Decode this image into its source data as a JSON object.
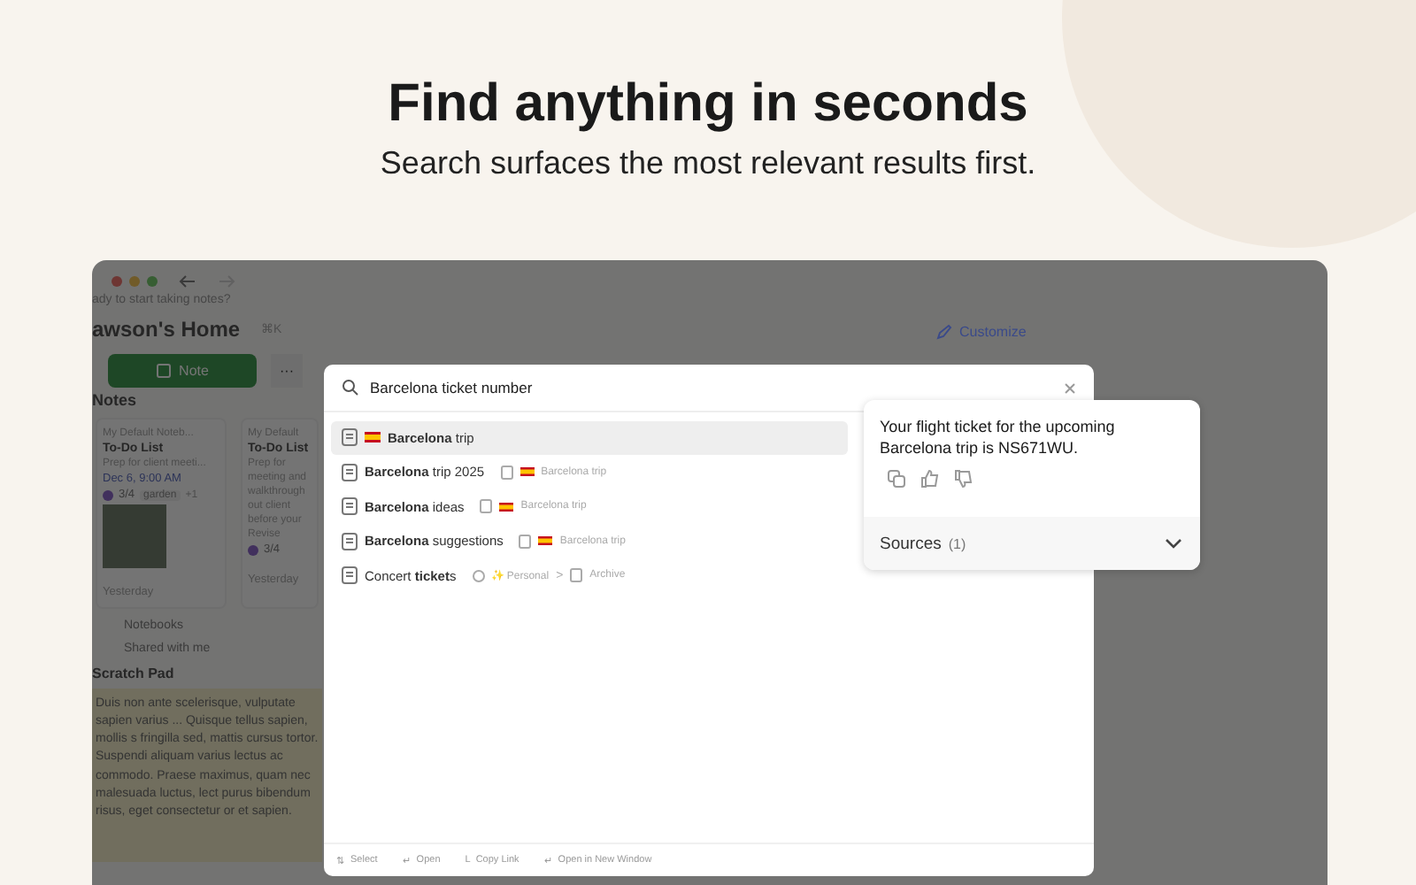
{
  "hero": {
    "title": "Find anything in seconds",
    "subtitle": "Search surfaces the most relevant results first."
  },
  "app": {
    "greeting": "ady to start taking notes?",
    "home_title": "awson's Home",
    "shortcut": "⌘K",
    "note_button": "Note",
    "more_button": "···",
    "customize": "Customize",
    "section": "Notes",
    "cards": [
      {
        "notebook": "My Default Noteb...",
        "title": "To-Do List",
        "lines": [
          "Prep for client meeti..."
        ],
        "date": "Dec 6, 9:00 AM",
        "progress": "3/4",
        "tag": "garden",
        "extra": "+1",
        "photo": true,
        "footer": "Yesterday"
      },
      {
        "notebook": "My Default",
        "title": "To-Do List",
        "lines": [
          "Prep for",
          "meeting and",
          "walkthrough",
          "out client",
          "before your",
          "Revise"
        ],
        "progress": "3/4",
        "footer": "Yesterday"
      }
    ],
    "sidebar": [
      "Notebooks",
      "Shared with me"
    ],
    "scratch_title": "Scratch Pad",
    "scratch_text": "Duis non ante scelerisque, vulputate sapien varius ... Quisque tellus sapien, mollis s fringilla sed, mattis cursus tortor. Suspendi aliquam varius lectus ac commodo. Praese maximus, quam nec malesuada luctus, lect purus bibendum risus, eget consectetur or et sapien."
  },
  "search": {
    "value": "Barcelona ticket number",
    "results": [
      {
        "title": "**Barcelona** trip",
        "flag": true,
        "selected": true
      },
      {
        "title": "**Barcelona** trip 2025",
        "selected": false,
        "path": [
          {
            "kind": "notebook",
            "flag": true,
            "label": "Barcelona trip"
          }
        ]
      },
      {
        "title": "**Barcelona** ideas",
        "selected": false,
        "path": [
          {
            "kind": "notebook",
            "flag": true,
            "label": "Barcelona trip"
          }
        ]
      },
      {
        "title": "**Barcelona** suggestions",
        "selected": false,
        "path": [
          {
            "kind": "notebook",
            "flag": true,
            "label": "Barcelona trip"
          }
        ]
      },
      {
        "title": "Concert **ticket**s",
        "selected": false,
        "path": [
          {
            "kind": "space",
            "label": "✨ Personal"
          },
          {
            "kind": "notebook",
            "separator": ">",
            "label": "Archive"
          }
        ]
      }
    ],
    "hints": [
      {
        "key": "⇅",
        "label": "Select"
      },
      {
        "key": "↵",
        "label": "Open"
      },
      {
        "key": "L",
        "label": "Copy Link"
      },
      {
        "key": "↵",
        "label": "Open in New Window"
      }
    ]
  },
  "answer": {
    "text": "Your flight ticket for the upcoming Barcelona trip is NS671WU.",
    "sources_label": "Sources",
    "sources_count": "(1)",
    "expanded": false
  }
}
